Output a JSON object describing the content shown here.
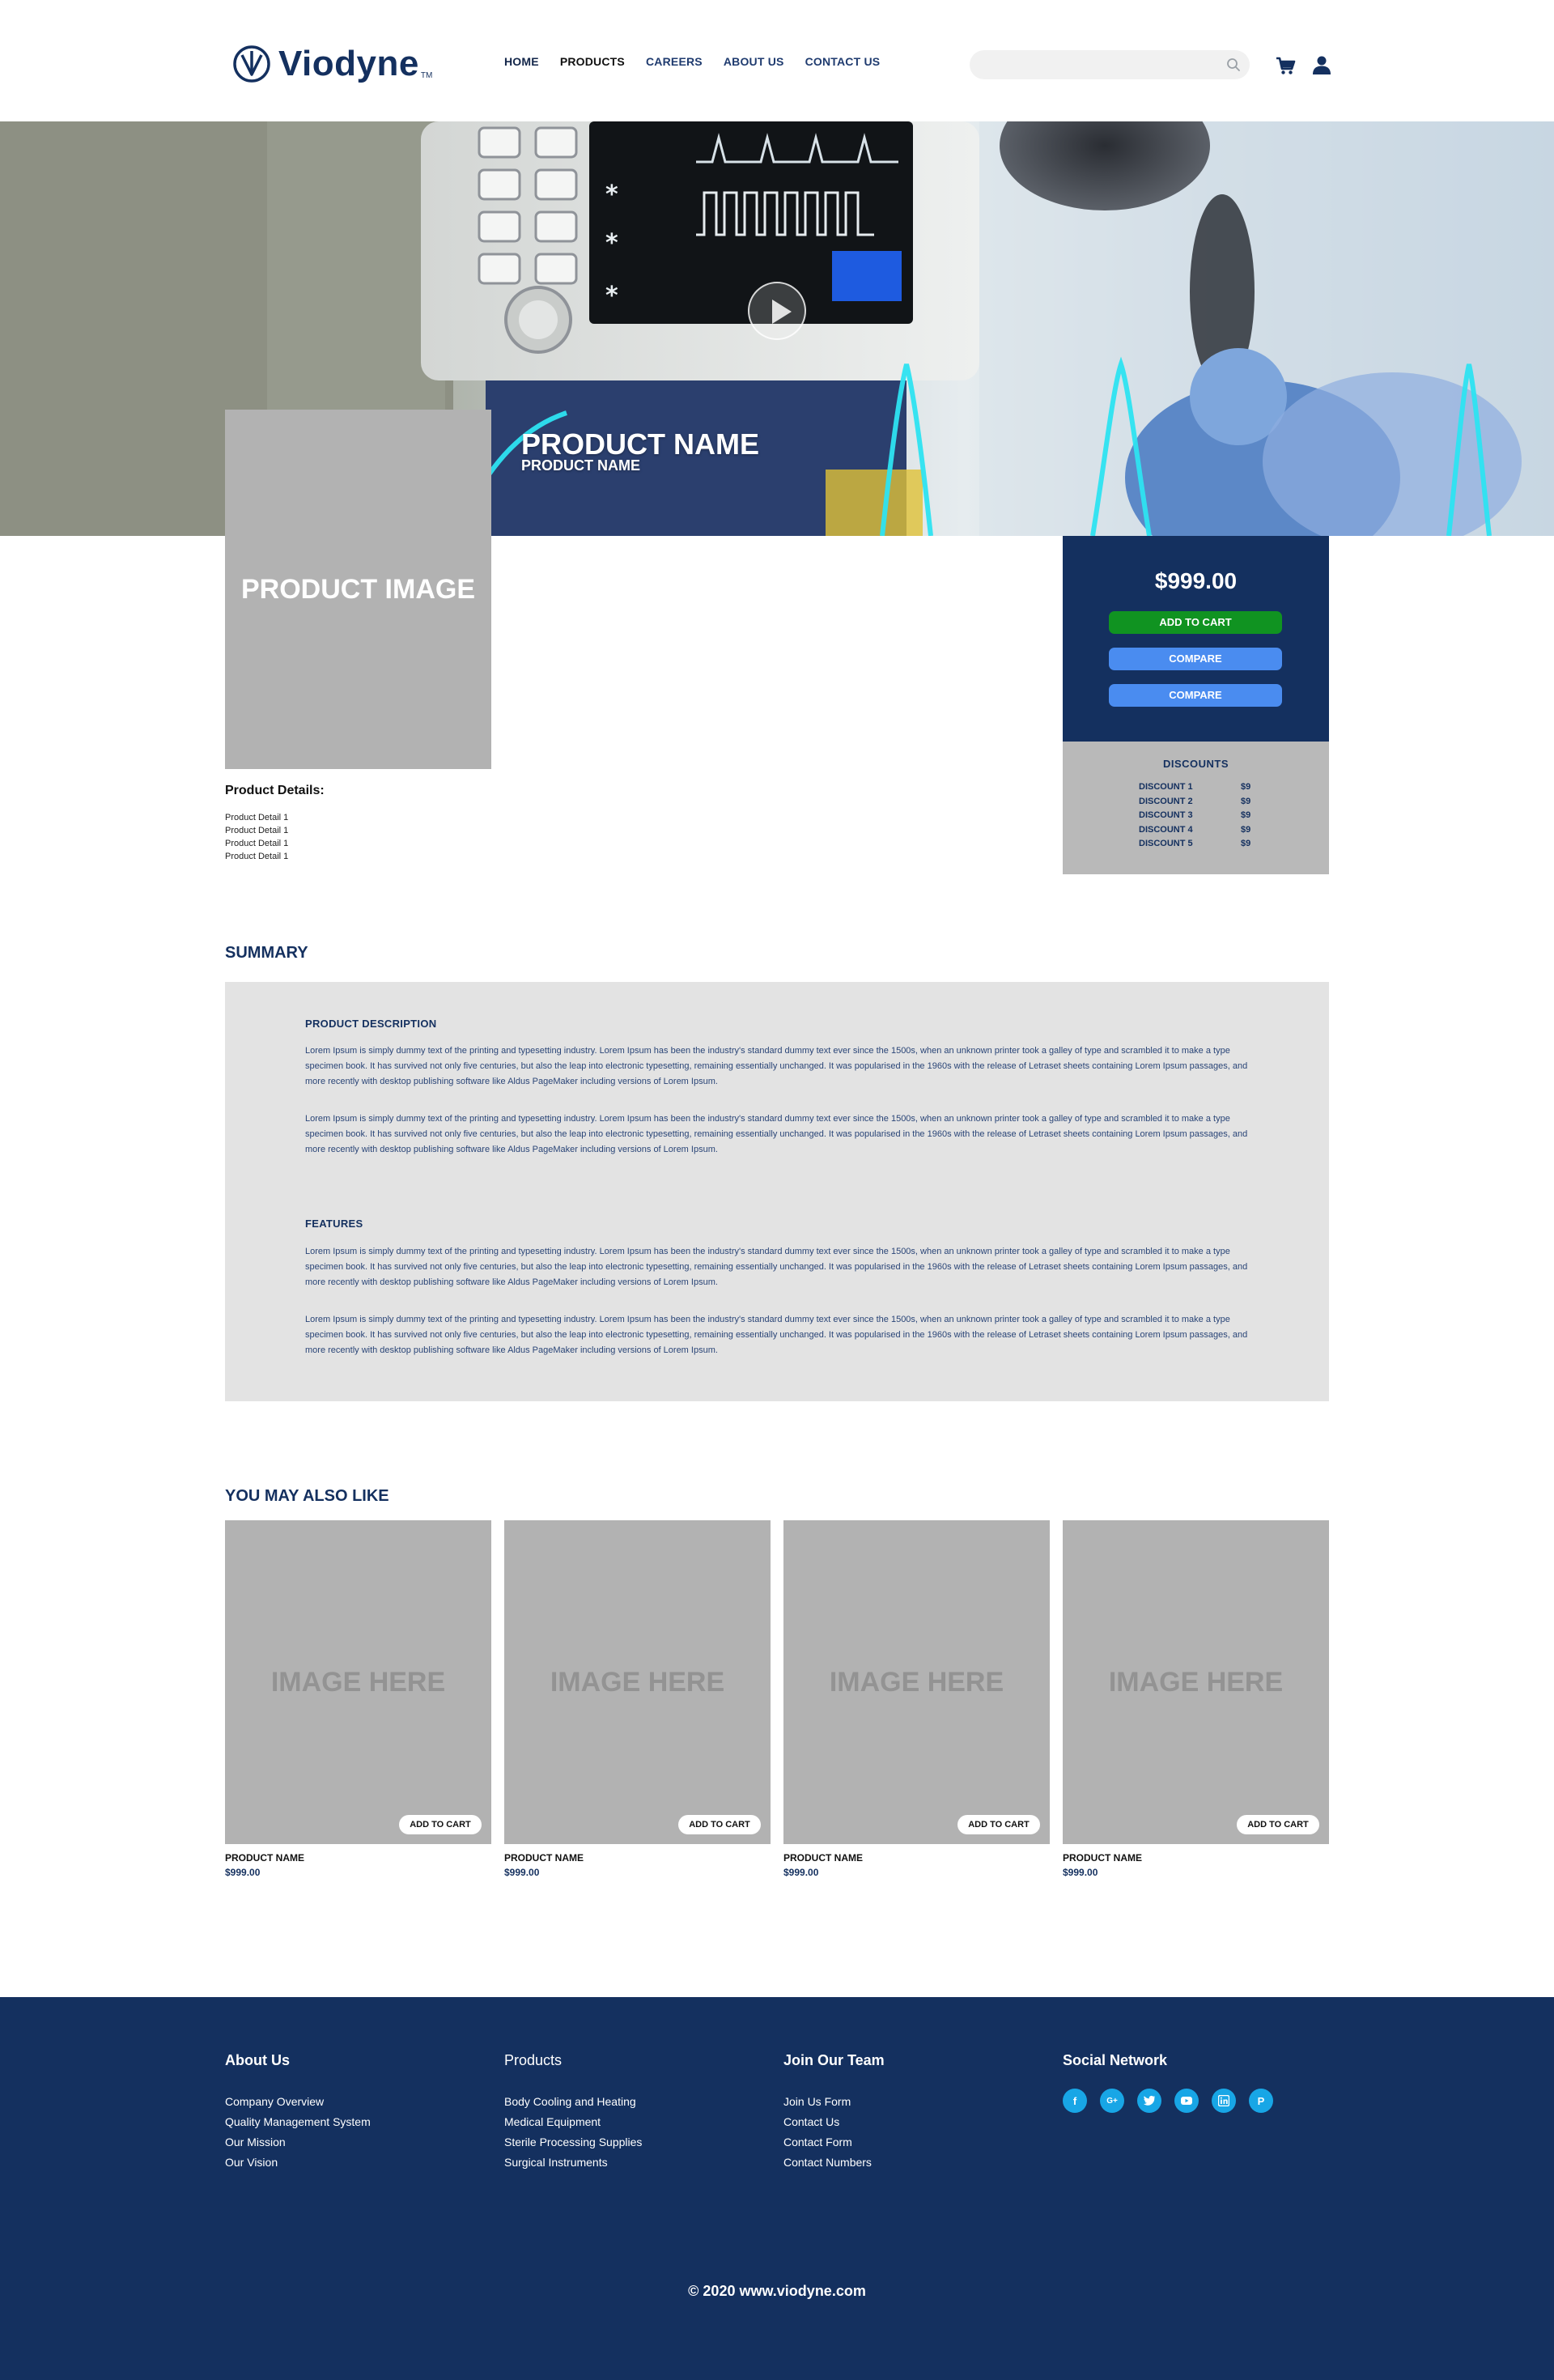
{
  "brand": {
    "name": "Viodyne",
    "tm": "TM"
  },
  "nav": [
    {
      "label": "HOME"
    },
    {
      "label": "PRODUCTS"
    },
    {
      "label": "CAREERS"
    },
    {
      "label": "ABOUT US"
    },
    {
      "label": "CONTACT US"
    }
  ],
  "search": {
    "placeholder": ""
  },
  "hero": {
    "title": "PRODUCT NAME",
    "subtitle": "PRODUCT NAME"
  },
  "product": {
    "image_label": "PRODUCT IMAGE",
    "details_title": "Product Details:",
    "details": [
      "Product Detail 1",
      "Product Detail 1",
      "Product Detail 1",
      "Product Detail 1"
    ]
  },
  "buy_box": {
    "price": "$999.00",
    "add_to_cart": "ADD TO CART",
    "compare_1": "COMPARE",
    "compare_2": "COMPARE"
  },
  "discounts": {
    "title": "DISCOUNTS",
    "rows": [
      {
        "label": "DISCOUNT 1",
        "value": "$9"
      },
      {
        "label": "DISCOUNT 2",
        "value": "$9"
      },
      {
        "label": "DISCOUNT 3",
        "value": "$9"
      },
      {
        "label": "DISCOUNT 4",
        "value": "$9"
      },
      {
        "label": "DISCOUNT 5",
        "value": "$9"
      }
    ]
  },
  "summary": {
    "heading": "SUMMARY",
    "description_title": "PRODUCT DESCRIPTION",
    "features_title": "FEATURES",
    "lorem": "Lorem Ipsum is simply dummy text of the printing and typesetting industry. Lorem Ipsum has been the industry's standard dummy text ever since the 1500s, when an unknown printer took a galley of type and scrambled it to make a type specimen book. It has survived not only five centuries, but also the leap into electronic typesetting, remaining essentially unchanged. It was popularised in the 1960s with the release of Letraset sheets containing Lorem Ipsum passages, and more recently with desktop publishing software like Aldus PageMaker including versions of Lorem Ipsum."
  },
  "related": {
    "heading": "YOU MAY ALSO LIKE",
    "items": [
      {
        "image_label": "IMAGE HERE",
        "button": "ADD TO CART",
        "name": "PRODUCT NAME",
        "price": "$999.00"
      },
      {
        "image_label": "IMAGE HERE",
        "button": "ADD TO CART",
        "name": "PRODUCT NAME",
        "price": "$999.00"
      },
      {
        "image_label": "IMAGE HERE",
        "button": "ADD TO CART",
        "name": "PRODUCT NAME",
        "price": "$999.00"
      },
      {
        "image_label": "IMAGE HERE",
        "button": "ADD TO CART",
        "name": "PRODUCT NAME",
        "price": "$999.00"
      }
    ]
  },
  "footer": {
    "about": {
      "title": "About Us",
      "links": [
        "Company Overview",
        "Quality Management System",
        "Our Mission",
        "Our Vision"
      ]
    },
    "products": {
      "title": "Products",
      "links": [
        "Body Cooling and Heating",
        "Medical Equipment",
        "Sterile Processing Supplies",
        "Surgical Instruments"
      ]
    },
    "join": {
      "title": "Join Our Team",
      "links": [
        "Join Us Form",
        "Contact Us",
        "Contact Form",
        "Contact Numbers"
      ]
    },
    "social": {
      "title": "Social Network",
      "icons": [
        "facebook-icon",
        "google-plus-icon",
        "twitter-icon",
        "youtube-icon",
        "linkedin-icon",
        "pinterest-icon"
      ]
    },
    "copyright": "© 2020 www.viodyne.com"
  },
  "colors": {
    "brand_navy": "#14305f",
    "add_to_cart_green": "#109321",
    "compare_blue": "#4a8cf0",
    "social_blue": "#18a6e6",
    "placeholder_gray": "#b2b2b2",
    "summary_bg": "#e3e3e3"
  }
}
